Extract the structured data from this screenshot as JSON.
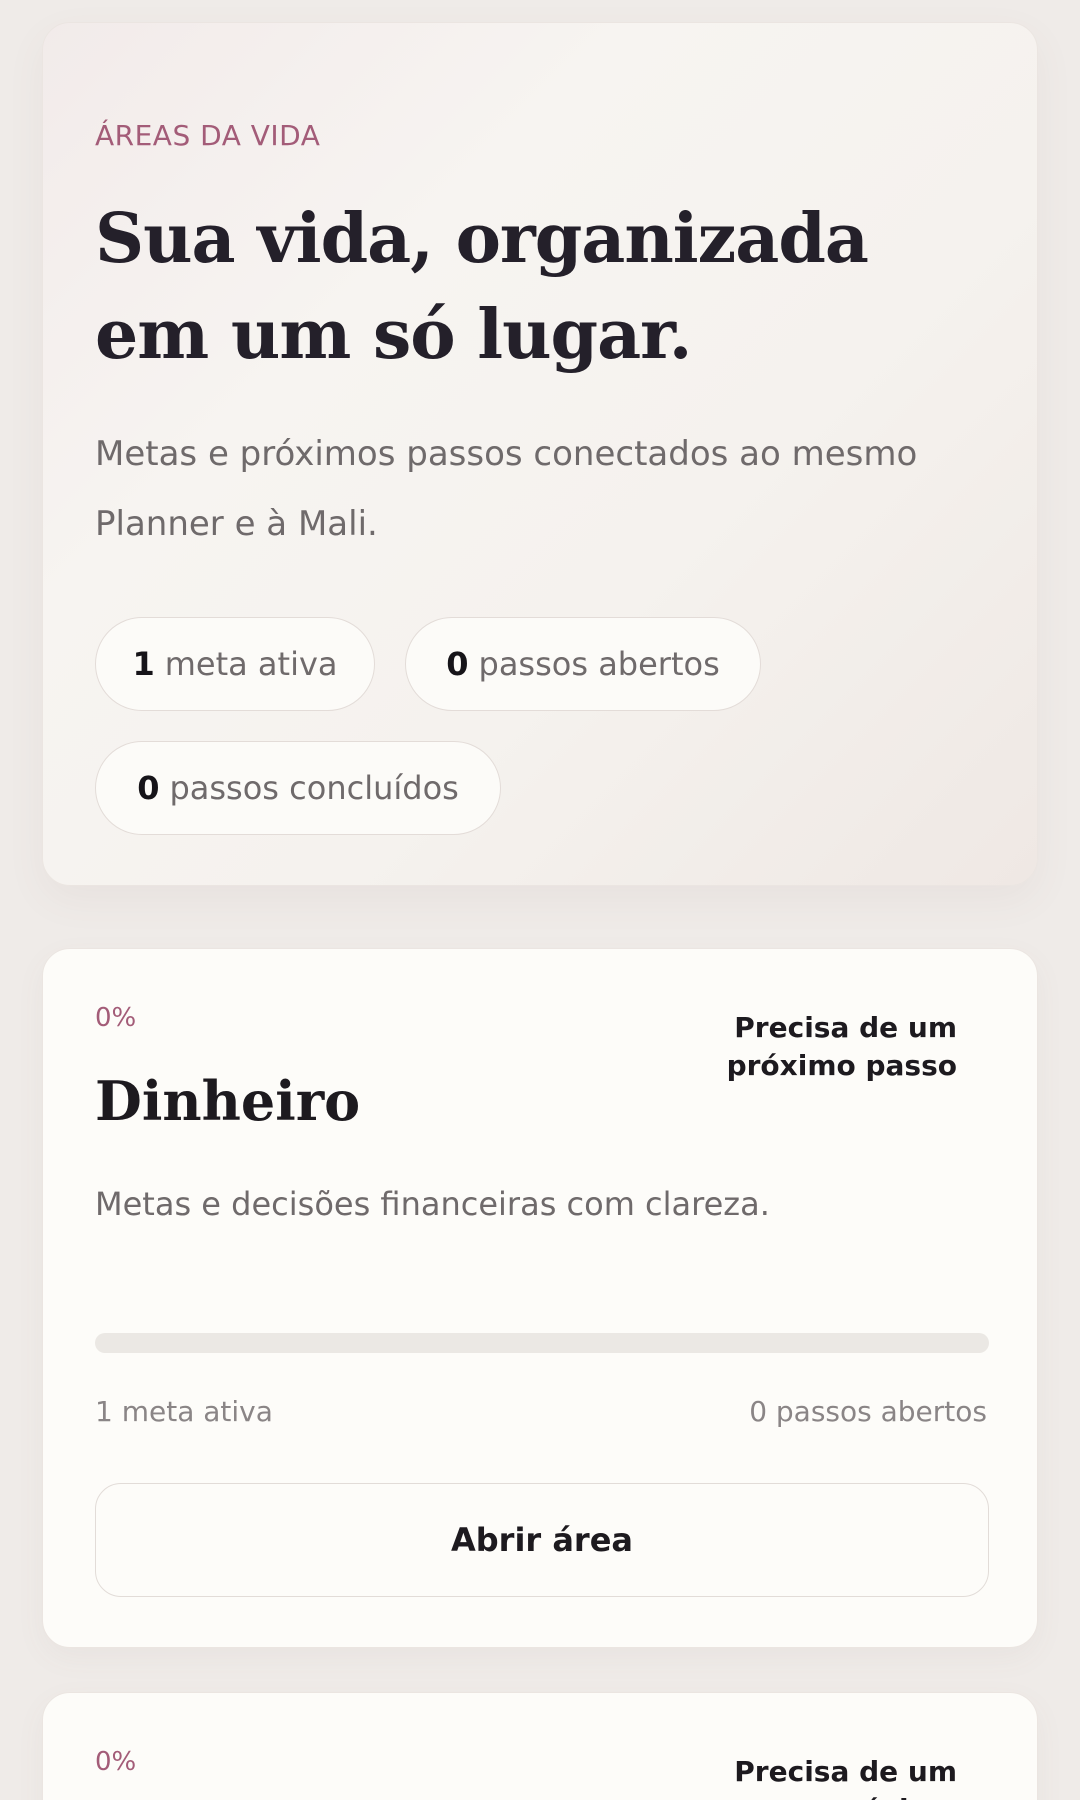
{
  "hero": {
    "eyebrow": "ÁREAS DA VIDA",
    "title": "Sua vida, organizada em um só lugar.",
    "subtitle": "Metas e próximos passos conectados ao mesmo Planner e à Mali.",
    "stats": [
      {
        "value": "1",
        "label": "meta ativa"
      },
      {
        "value": "0",
        "label": "passos abertos"
      },
      {
        "value": "0",
        "label": "passos concluídos"
      }
    ]
  },
  "areas": [
    {
      "percent": "0%",
      "progress_fraction": 0,
      "status": "Precisa de um próximo passo",
      "title": "Dinheiro",
      "description": "Metas e decisões financeiras com clareza.",
      "active_goals": "1 meta ativa",
      "open_steps": "0 passos abertos",
      "button_label": "Abrir área"
    },
    {
      "percent": "0%",
      "status": "Precisa de um próximo"
    }
  ],
  "colors": {
    "accent": "#a35c78",
    "background": "#efebe8",
    "card": "#fdfcf9",
    "text": "#1d1a1f",
    "muted": "#6f6a6b"
  }
}
